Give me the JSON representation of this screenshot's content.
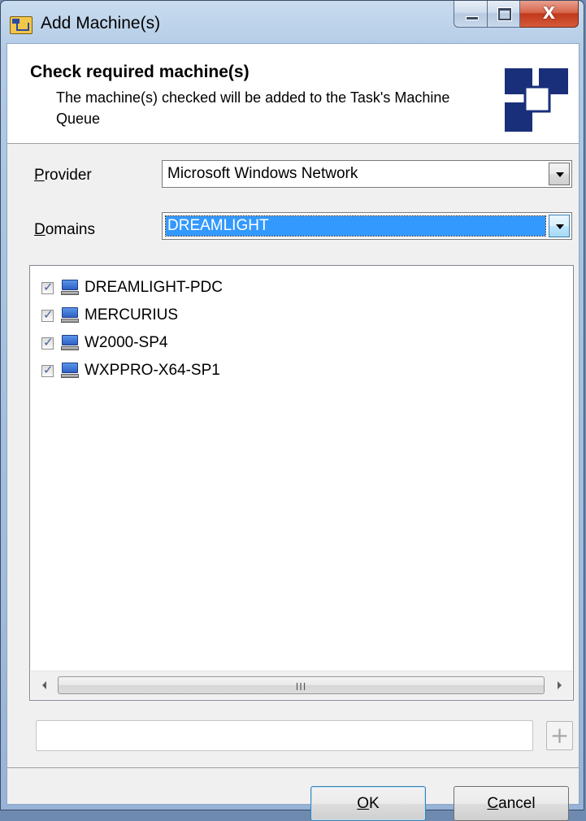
{
  "window": {
    "title": "Add Machine(s)",
    "close_glyph": "X"
  },
  "header": {
    "title": "Check required machine(s)",
    "description": "The machine(s) checked will be added to the Task's Machine Queue",
    "logo_icon": "blue-squares-logo"
  },
  "provider": {
    "label_mnemonic": "P",
    "label_rest": "rovider",
    "value": "Microsoft Windows Network"
  },
  "domains": {
    "label_mnemonic": "D",
    "label_rest": "omains",
    "value": "DREAMLIGHT"
  },
  "machines": {
    "items": [
      {
        "label": "DREAMLIGHT-PDC",
        "checked": true,
        "icon": "computer-icon"
      },
      {
        "label": "MERCURIUS",
        "checked": true,
        "icon": "computer-icon"
      },
      {
        "label": "W2000-SP4",
        "checked": true,
        "icon": "computer-icon"
      },
      {
        "label": "WXPPRO-X64-SP1",
        "checked": true,
        "icon": "computer-icon"
      }
    ],
    "scroll_grip": "III"
  },
  "add_field": {
    "value": "",
    "add_glyph": "+"
  },
  "buttons": {
    "ok_mnemonic": "O",
    "ok_rest": "K",
    "cancel_mnemonic": "C",
    "cancel_rest": "ancel"
  },
  "colors": {
    "selection": "#3399ff",
    "logo_blue": "#1a2f7a",
    "close_red": "#c2391c"
  }
}
